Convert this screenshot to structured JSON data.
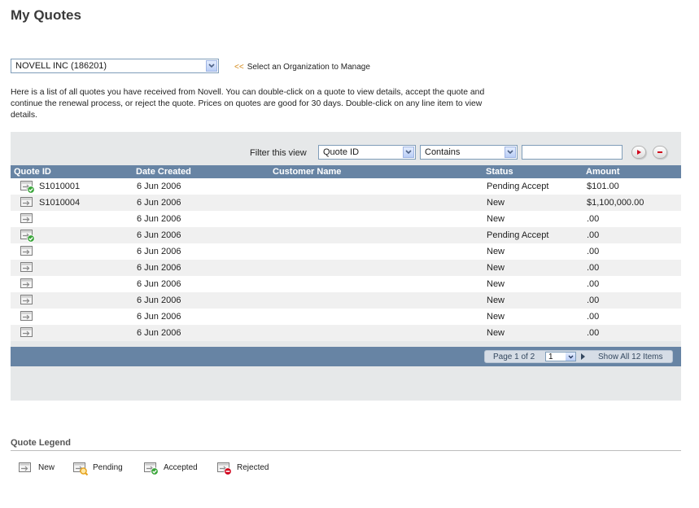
{
  "page": {
    "title": "My Quotes"
  },
  "organization": {
    "selected": "NOVELL INC  (186201)",
    "hint_arrows": "<<",
    "hint": "Select an Organization to Manage"
  },
  "intro_text": "Here is a list of all quotes you have received from Novell. You can double-click on a quote to view details, accept the quote and continue the renewal process, or reject the quote. Prices on quotes are good for 30 days. Double-click on any line item to view details.",
  "filter": {
    "label": "Filter this view",
    "field_value": "Quote ID",
    "operator_value": "Contains",
    "text_value": ""
  },
  "grid": {
    "columns": [
      "Quote ID",
      "Date Created",
      "Customer Name",
      "Status",
      "Amount"
    ],
    "rows": [
      {
        "icon": "quote-accepted-icon",
        "quote_id": "S1010001",
        "date": "6 Jun 2006",
        "customer": "",
        "status": "Pending Accept",
        "amount": "$101.00"
      },
      {
        "icon": "quote-new-icon",
        "quote_id": "S1010004",
        "date": "6 Jun 2006",
        "customer": "",
        "status": "New",
        "amount": "$1,100,000.00"
      },
      {
        "icon": "quote-new-icon",
        "quote_id": "",
        "date": "6 Jun 2006",
        "customer": "",
        "status": "New",
        "amount": ".00"
      },
      {
        "icon": "quote-accepted-icon",
        "quote_id": "",
        "date": "6 Jun 2006",
        "customer": "",
        "status": "Pending Accept",
        "amount": ".00"
      },
      {
        "icon": "quote-new-icon",
        "quote_id": "",
        "date": "6 Jun 2006",
        "customer": "",
        "status": "New",
        "amount": ".00"
      },
      {
        "icon": "quote-new-icon",
        "quote_id": "",
        "date": "6 Jun 2006",
        "customer": "",
        "status": "New",
        "amount": ".00"
      },
      {
        "icon": "quote-new-icon",
        "quote_id": "",
        "date": "6 Jun 2006",
        "customer": "",
        "status": "New",
        "amount": ".00"
      },
      {
        "icon": "quote-new-icon",
        "quote_id": "",
        "date": "6 Jun 2006",
        "customer": "",
        "status": "New",
        "amount": ".00"
      },
      {
        "icon": "quote-new-icon",
        "quote_id": "",
        "date": "6 Jun 2006",
        "customer": "",
        "status": "New",
        "amount": ".00"
      },
      {
        "icon": "quote-new-icon",
        "quote_id": "",
        "date": "6 Jun 2006",
        "customer": "",
        "status": "New",
        "amount": ".00"
      }
    ]
  },
  "pager": {
    "page_text": "Page 1 of 2",
    "page_value": "1",
    "show_all": "Show All 12 Items"
  },
  "legend": {
    "title": "Quote Legend",
    "items": [
      {
        "icon": "quote-new-icon",
        "label": "New"
      },
      {
        "icon": "quote-pending-icon",
        "label": "Pending"
      },
      {
        "icon": "quote-accepted-icon",
        "label": "Accepted"
      },
      {
        "icon": "quote-rejected-icon",
        "label": "Rejected"
      }
    ]
  },
  "colors": {
    "grid_header": "#6784a4",
    "panel": "#e6e8e9",
    "accepted": "#3aa53a",
    "rejected": "#d0021b",
    "pending": "#e6a11a"
  }
}
